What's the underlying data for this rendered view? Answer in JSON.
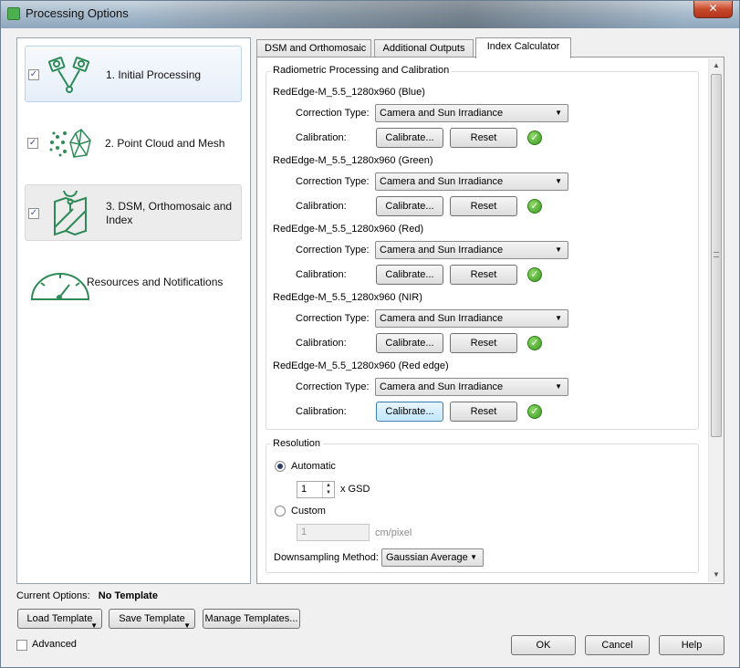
{
  "window": {
    "title": "Processing Options",
    "close_glyph": "✕"
  },
  "steps": [
    {
      "label": "1. Initial Processing",
      "checked": true,
      "icon": "camera-pair-icon"
    },
    {
      "label": "2. Point Cloud and Mesh",
      "checked": true,
      "icon": "point-cloud-icon"
    },
    {
      "label_line1": "3. DSM, Orthomosaic and",
      "label_line2": "Index",
      "checked": true,
      "icon": "map-pin-icon"
    },
    {
      "label": "Resources and Notifications",
      "icon": "gauge-icon"
    }
  ],
  "tabs": [
    "DSM and Orthomosaic",
    "Additional Outputs",
    "Index Calculator"
  ],
  "active_tab": "Index Calculator",
  "radiometric": {
    "title": "Radiometric Processing and Calibration",
    "correction_label": "Correction Type:",
    "calibration_label": "Calibration:",
    "calibrate_label": "Calibrate...",
    "reset_label": "Reset",
    "bands": [
      {
        "camera": "RedEdge-M_5.5_1280x960 (Blue)",
        "correction": "Camera and Sun Irradiance"
      },
      {
        "camera": "RedEdge-M_5.5_1280x960 (Green)",
        "correction": "Camera and Sun Irradiance"
      },
      {
        "camera": "RedEdge-M_5.5_1280x960 (Red)",
        "correction": "Camera and Sun Irradiance"
      },
      {
        "camera": "RedEdge-M_5.5_1280x960 (NIR)",
        "correction": "Camera and Sun Irradiance"
      },
      {
        "camera": "RedEdge-M_5.5_1280x960 (Red edge)",
        "correction": "Camera and Sun Irradiance"
      }
    ]
  },
  "resolution": {
    "title": "Resolution",
    "automatic_label": "Automatic",
    "automatic_value": "1",
    "gsd_unit": "x GSD",
    "custom_label": "Custom",
    "custom_value": "1",
    "custom_unit": "cm/pixel",
    "downsampling_label": "Downsampling Method:",
    "downsampling_value": "Gaussian Average"
  },
  "footer": {
    "current_options_label": "Current Options:",
    "current_options_value": "No Template",
    "load_template": "Load Template",
    "save_template": "Save Template",
    "manage_templates": "Manage Templates...",
    "advanced_label": "Advanced",
    "ok": "OK",
    "cancel": "Cancel",
    "help": "Help"
  },
  "colors": {
    "accent_green": "#2e8b57",
    "check_green": "#3a9a20"
  }
}
